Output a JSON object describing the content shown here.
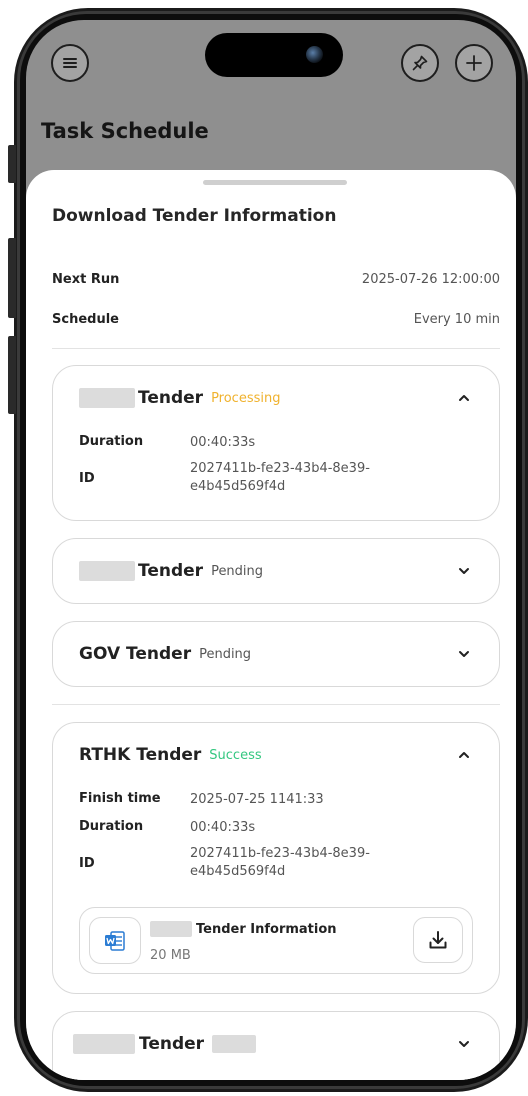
{
  "header": {
    "background_title": "Task Schedule"
  },
  "sheet": {
    "title": "Download Tender Information",
    "next_run_label": "Next Run",
    "next_run_value": "2025-07-26 12:00:00",
    "schedule_label": "Schedule",
    "schedule_value": "Every 10 min"
  },
  "tasks": [
    {
      "name": "Tender",
      "status": "Processing",
      "expanded": true,
      "duration_label": "Duration",
      "duration_value": "00:40:33s",
      "id_label": "ID",
      "id_line1": "2027411b-fe23-43b4-8e39-",
      "id_line2": "e4b45d569f4d"
    },
    {
      "name": "Tender",
      "status": "Pending",
      "expanded": false
    },
    {
      "name": "GOV Tender",
      "status": "Pending",
      "expanded": false
    },
    {
      "name": "RTHK Tender",
      "status": "Success",
      "expanded": true,
      "finish_label": "Finish time",
      "finish_value": "2025-07-25 1141:33",
      "duration_label": "Duration",
      "duration_value": "00:40:33s",
      "id_label": "ID",
      "id_line1": "2027411b-fe23-43b4-8e39-",
      "id_line2": "e4b45d569f4d",
      "file": {
        "name": "Tender Information",
        "size_prefix": "20",
        "size_suffix": "MB",
        "icon": "word-doc-icon"
      }
    },
    {
      "name": "Tender",
      "status": "",
      "expanded": false
    }
  ],
  "colors": {
    "processing": "#f0b22e",
    "success": "#34c780",
    "word_blue": "#2b7cd3"
  },
  "icons": {
    "menu": "menu-icon",
    "pin": "pin-icon",
    "add": "plus-icon",
    "download": "download-icon",
    "chevron_up": "chevron-up-icon",
    "chevron_down": "chevron-down-icon"
  }
}
